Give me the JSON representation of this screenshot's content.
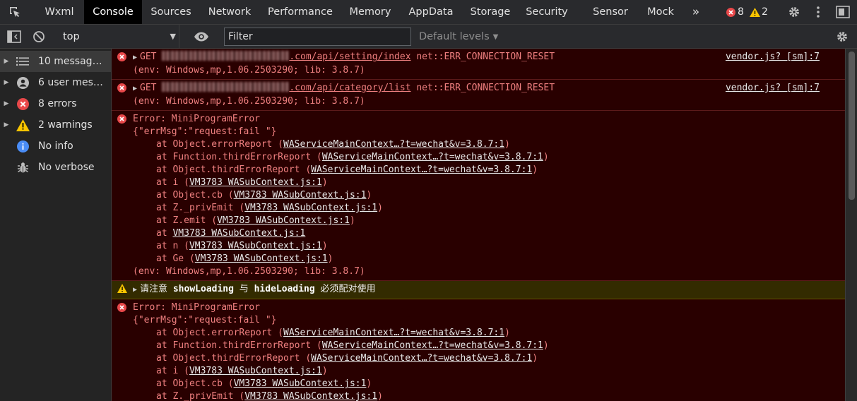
{
  "tabs": [
    "Wxml",
    "Console",
    "Sources",
    "Network",
    "Performance",
    "Memory",
    "AppData",
    "Storage",
    "Security",
    "Sensor",
    "Mock"
  ],
  "active_tab": "Console",
  "more_tabs_glyph": "»",
  "counts": {
    "errors": "8",
    "warnings": "2"
  },
  "toolbar": {
    "context": "top",
    "filter_placeholder": "Filter",
    "levels": "Default levels"
  },
  "sidebar": [
    {
      "label": "10 messages",
      "icon": "list-icon",
      "expandable": true,
      "selected": true
    },
    {
      "label": "6 user mess...",
      "icon": "user-icon",
      "expandable": true,
      "selected": false
    },
    {
      "label": "8 errors",
      "icon": "error-icon",
      "expandable": true,
      "selected": false
    },
    {
      "label": "2 warnings",
      "icon": "warning-icon",
      "expandable": true,
      "selected": false
    },
    {
      "label": "No info",
      "icon": "info-icon",
      "expandable": false,
      "selected": false
    },
    {
      "label": "No verbose",
      "icon": "bug-icon",
      "expandable": false,
      "selected": false
    }
  ],
  "messages": [
    {
      "get": "GET",
      "url_suffix": ".com/api/setting/index",
      "status": "net::ERR_CONNECTION_RESET",
      "source": "vendor.js? [sm]:7",
      "env": "(env: Windows,mp,1.06.2503290; lib: 3.8.7)"
    },
    {
      "get": "GET",
      "url_suffix": ".com/api/category/list",
      "status": "net::ERR_CONNECTION_RESET",
      "source": "vendor.js? [sm]:7",
      "env": "(env: Windows,mp,1.06.2503290; lib: 3.8.7)"
    }
  ],
  "error_block_1": {
    "title": "Error: MiniProgramError",
    "payload": "{\"errMsg\":\"request:fail \"}",
    "stack": [
      {
        "fn": "at Object.errorReport (",
        "loc": "WAServiceMainContext…?t=wechat&v=3.8.7:1",
        "end": ")"
      },
      {
        "fn": "at Function.thirdErrorReport (",
        "loc": "WAServiceMainContext…?t=wechat&v=3.8.7:1",
        "end": ")"
      },
      {
        "fn": "at Object.thirdErrorReport (",
        "loc": "WAServiceMainContext…?t=wechat&v=3.8.7:1",
        "end": ")"
      },
      {
        "fn": "at i (",
        "loc": "VM3783 WASubContext.js:1",
        "end": ")"
      },
      {
        "fn": "at Object.cb (",
        "loc": "VM3783 WASubContext.js:1",
        "end": ")"
      },
      {
        "fn": "at Z._privEmit (",
        "loc": "VM3783 WASubContext.js:1",
        "end": ")"
      },
      {
        "fn": "at Z.emit (",
        "loc": "VM3783 WASubContext.js:1",
        "end": ")"
      },
      {
        "fn": "at ",
        "loc": "VM3783 WASubContext.js:1",
        "end": ""
      },
      {
        "fn": "at n (",
        "loc": "VM3783 WASubContext.js:1",
        "end": ")"
      },
      {
        "fn": "at Ge (",
        "loc": "VM3783 WASubContext.js:1",
        "end": ")"
      }
    ],
    "env": "(env: Windows,mp,1.06.2503290; lib: 3.8.7)"
  },
  "warning": {
    "pre": "请注意 ",
    "b1": "showLoading",
    "mid": " 与 ",
    "b2": "hideLoading",
    "post": " 必须配对使用"
  },
  "error_block_2": {
    "title": "Error: MiniProgramError",
    "payload": "{\"errMsg\":\"request:fail \"}",
    "stack": [
      {
        "fn": "at Object.errorReport (",
        "loc": "WAServiceMainContext…?t=wechat&v=3.8.7:1",
        "end": ")"
      },
      {
        "fn": "at Function.thirdErrorReport (",
        "loc": "WAServiceMainContext…?t=wechat&v=3.8.7:1",
        "end": ")"
      },
      {
        "fn": "at Object.thirdErrorReport (",
        "loc": "WAServiceMainContext…?t=wechat&v=3.8.7:1",
        "end": ")"
      },
      {
        "fn": "at i (",
        "loc": "VM3783 WASubContext.js:1",
        "end": ")"
      },
      {
        "fn": "at Object.cb (",
        "loc": "VM3783 WASubContext.js:1",
        "end": ")"
      },
      {
        "fn": "at Z._privEmit (",
        "loc": "VM3783 WASubContext.js:1",
        "end": ")"
      }
    ]
  },
  "colors": {
    "error_bg": "#290000",
    "error_text": "#f08080",
    "warning_bg": "#332b00",
    "error_icon": "#e8484a",
    "warning_icon": "#f9c500",
    "info_icon": "#4a8df6"
  }
}
